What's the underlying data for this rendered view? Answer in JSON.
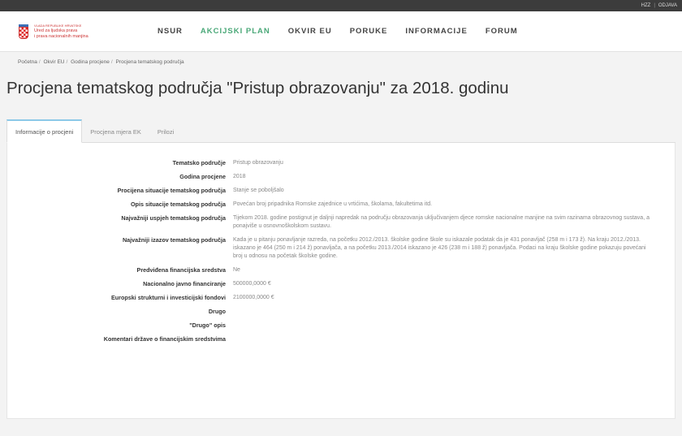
{
  "topbar": {
    "user": "HZZ",
    "separator": "|",
    "logout": "ODJAVA"
  },
  "header": {
    "logo_line1": "VLADA REPUBLIKE HRVATSKE",
    "logo_line2": "Ured za ljudska prava",
    "logo_line3": "i prava nacionalnih manjina",
    "nav": [
      "NSUR",
      "AKCIJSKI PLAN",
      "OKVIR EU",
      "PORUKE",
      "INFORMACIJE",
      "FORUM"
    ]
  },
  "breadcrumb": [
    "Početna",
    "Okvir EU",
    "Godina procjene",
    "Procjena tematskog područja"
  ],
  "page_title": "Procjena tematskog područja \"Pristup obrazovanju\" za 2018. godinu",
  "tabs": [
    "Informacije o procjeni",
    "Procjena mjera EK",
    "Prilozi"
  ],
  "details": [
    {
      "label": "Tematsko područje",
      "value": "Pristup obrazovanju"
    },
    {
      "label": "Godina procjene",
      "value": "2018"
    },
    {
      "label": "Procijena situacije tematskog područja",
      "value": "Stanje se poboljšalo"
    },
    {
      "label": "Opis situacije tematskog područja",
      "value": "Povećan broj pripadnika Romske zajednice u vrtićima, školama, fakultetima itd."
    },
    {
      "label": "Najvažniji uspjeh tematskog područja",
      "value": "Tijekom 2018. godine postignut je daljnji napredak na području obrazovanja uključivanjem djece romske nacionalne manjine na svim razinama obrazovnog sustava, a ponajviše u osnovnoškolskom sustavu."
    },
    {
      "label": "Najvažniji izazov tematskog područja",
      "value": "Kada je u pitanju ponavljanje razreda, na početku 2012./2013. školske godine škole su iskazale podatak da je 431 ponavljač (258 m i 173 ž). Na kraju 2012./2013. iskazano je 464 (250 m i 214 ž) ponavljača, a na početku 2013./2014 iskazano je 426 (238 m i 188 ž) ponavljača. Podaci na kraju školske godine pokazuju povećani broj u odnosu na početak školske godine."
    },
    {
      "label": "Predviđena financijska sredstva",
      "value": "Ne"
    },
    {
      "label": "Nacionalno javno financiranje",
      "value": "500000,0000 €"
    },
    {
      "label": "Europski strukturni i investicijski fondovi",
      "value": "2100000,0000 €"
    },
    {
      "label": "Drugo",
      "value": ""
    },
    {
      "label": "\"Drugo\" opis",
      "value": ""
    },
    {
      "label": "Komentari države o financijskim sredstvima",
      "value": ""
    }
  ],
  "colors": {
    "active_nav": "#4aa878",
    "tab_accent": "#8cc9e8",
    "topbar": "#3c3c3c"
  }
}
